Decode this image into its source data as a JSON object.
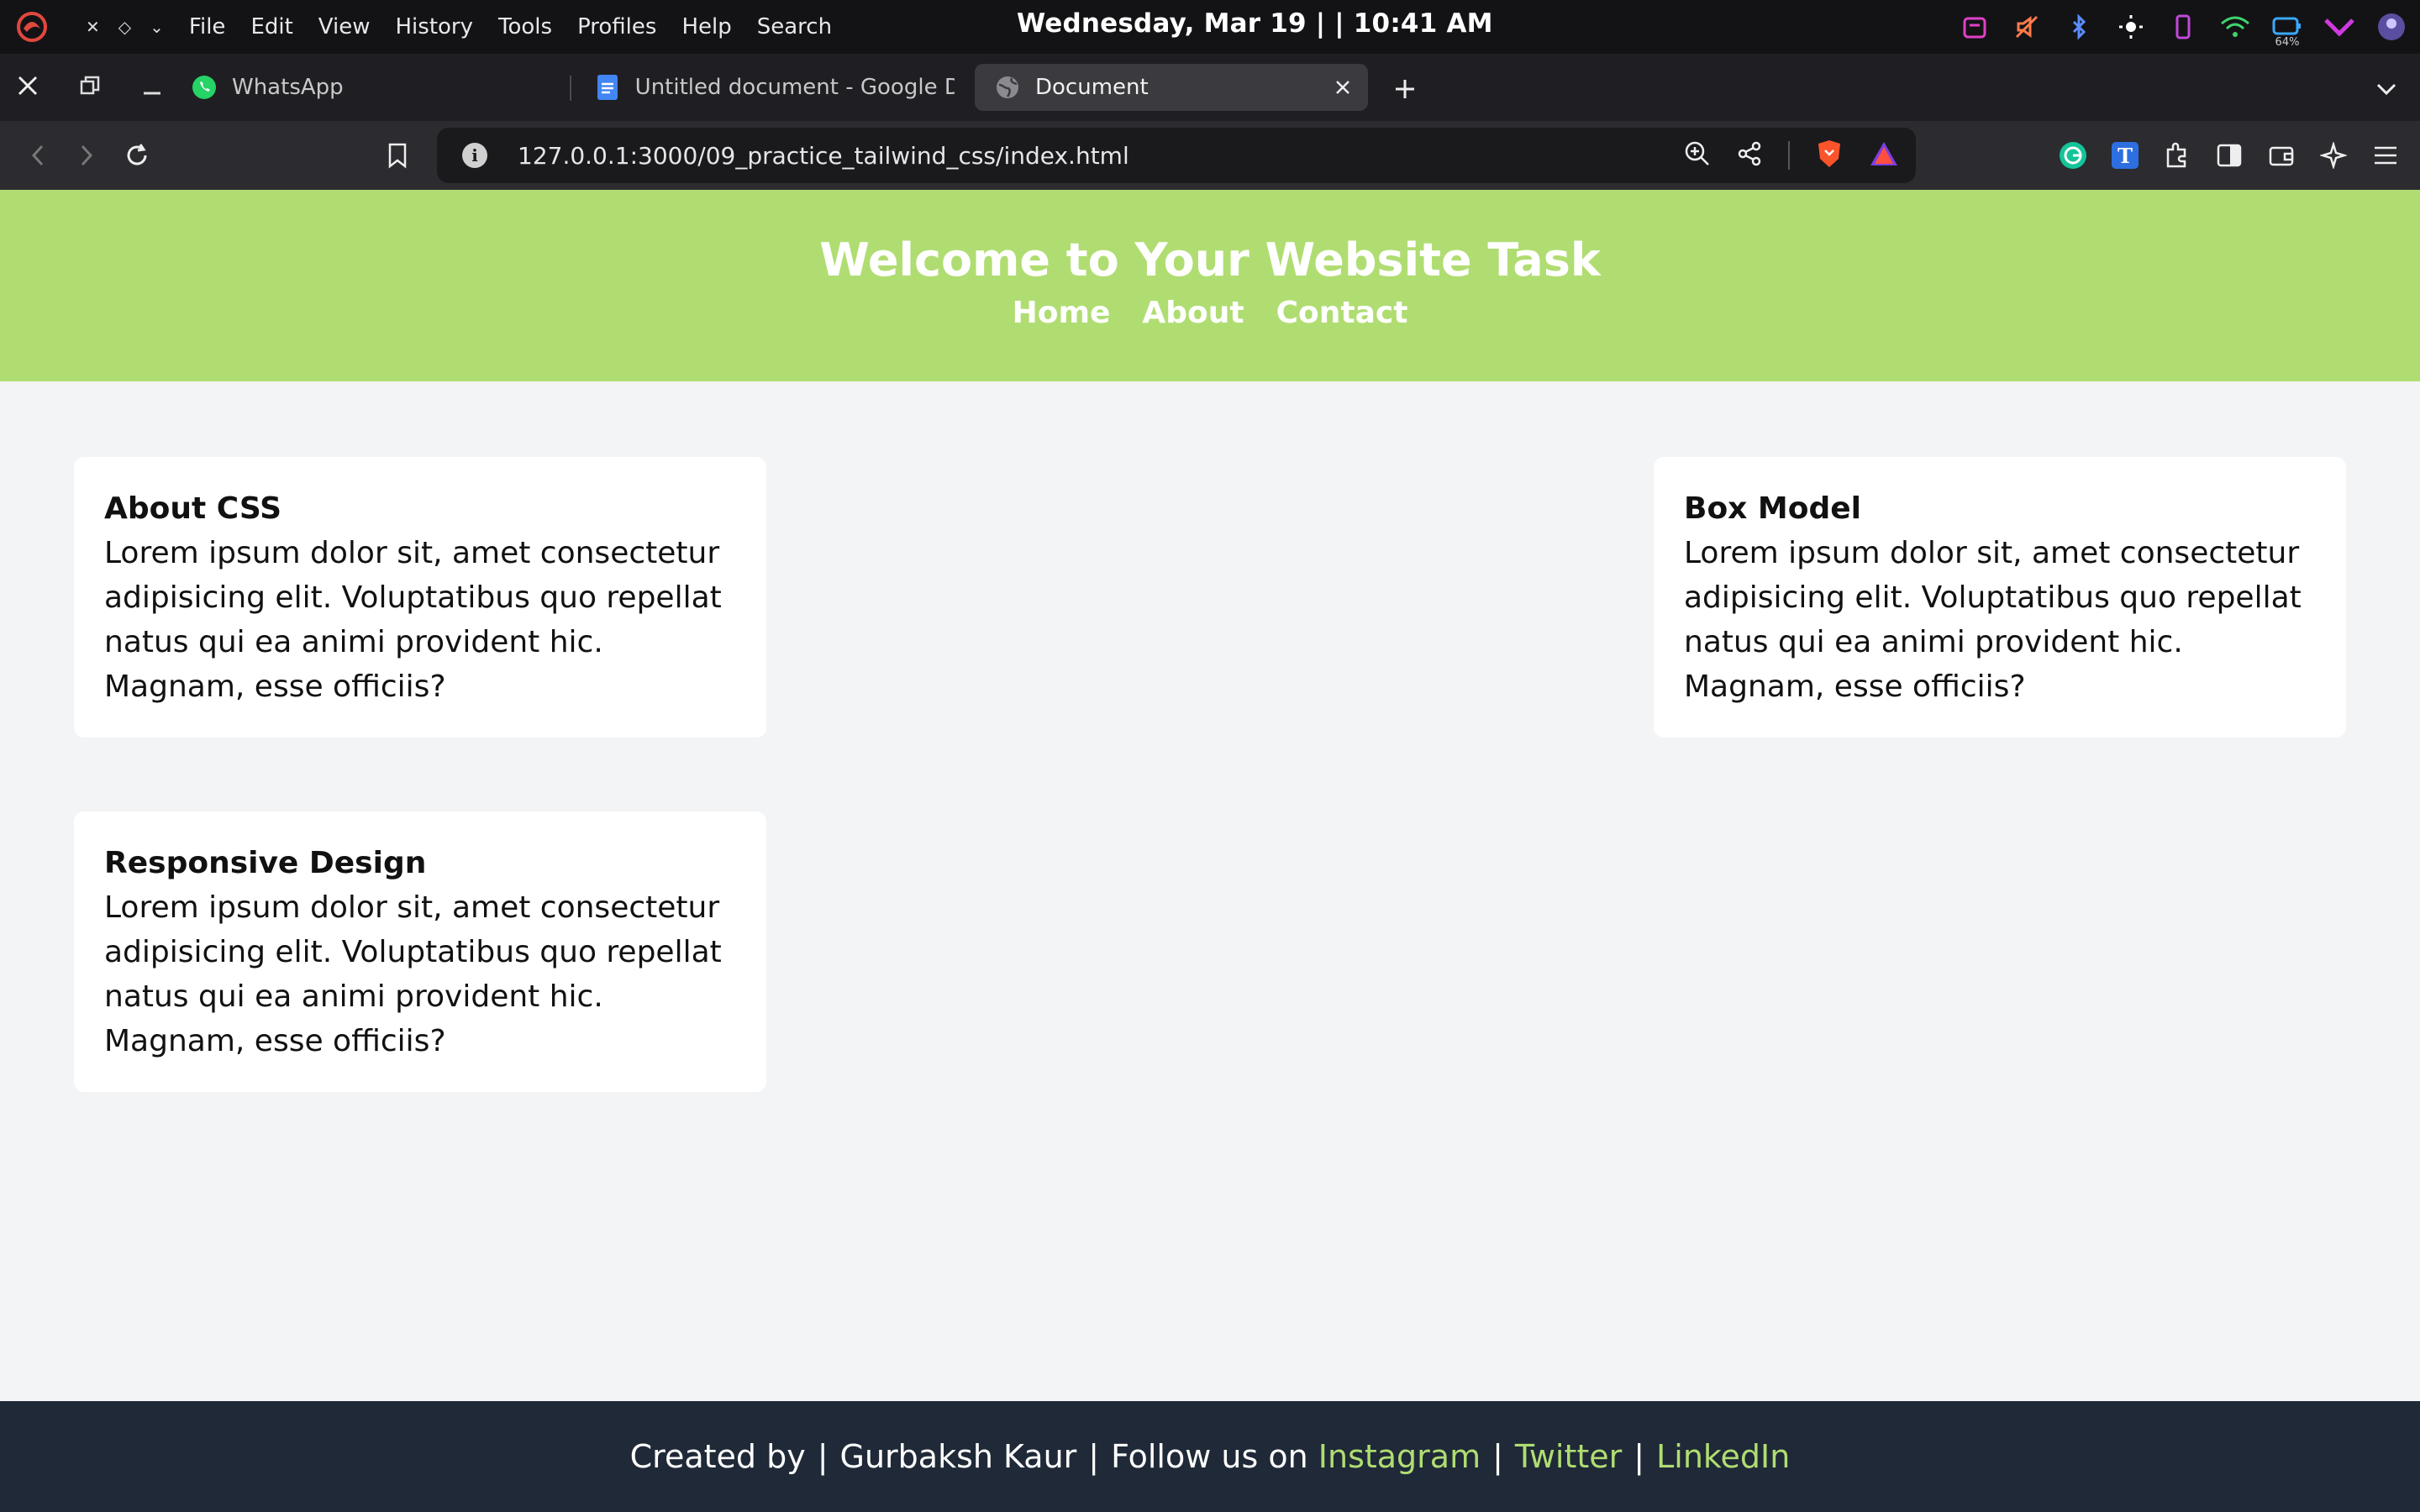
{
  "system": {
    "menu": [
      "File",
      "Edit",
      "View",
      "History",
      "Tools",
      "Profiles",
      "Help",
      "Search"
    ],
    "clock": "Wednesday, Mar 19 | | 10:41 AM",
    "battery_percent": "64%"
  },
  "tabs": [
    {
      "title": "WhatsApp",
      "favicon": "whatsapp-icon"
    },
    {
      "title": "Untitled document - Google Docs",
      "favicon": "google-docs-icon"
    },
    {
      "title": "Document",
      "favicon": "globe-icon",
      "active": true
    }
  ],
  "address_bar": {
    "url": "127.0.0.1:3000/09_practice_tailwind_css/index.html"
  },
  "page": {
    "header": {
      "title": "Welcome to Your Website Task",
      "nav": [
        "Home",
        "About",
        "Contact"
      ]
    },
    "cards": [
      {
        "title": "About CSS",
        "body": "Lorem ipsum dolor sit, amet consectetur adipisicing elit. Voluptatibus quo repellat natus qui ea animi provident hic. Magnam, esse officiis?"
      },
      {
        "title": "Box Model",
        "body": "Lorem ipsum dolor sit, amet consectetur adipisicing elit. Voluptatibus quo repellat natus qui ea animi provident hic. Magnam, esse officiis?"
      },
      {
        "title": "Responsive Design",
        "body": "Lorem ipsum dolor sit, amet consectetur adipisicing elit. Voluptatibus quo repellat natus qui ea animi provident hic. Magnam, esse officiis?"
      }
    ],
    "footer": {
      "created_by": "Created by",
      "author": "Gurbaksh Kaur",
      "follow": "Follow us on",
      "links": [
        "Instagram",
        "Twitter",
        "LinkedIn"
      ],
      "separator": "|"
    }
  },
  "colors": {
    "header_bg": "#b0dd72",
    "footer_bg": "#1f2937",
    "link_color": "#b0dd72",
    "page_bg": "#f3f4f6"
  }
}
